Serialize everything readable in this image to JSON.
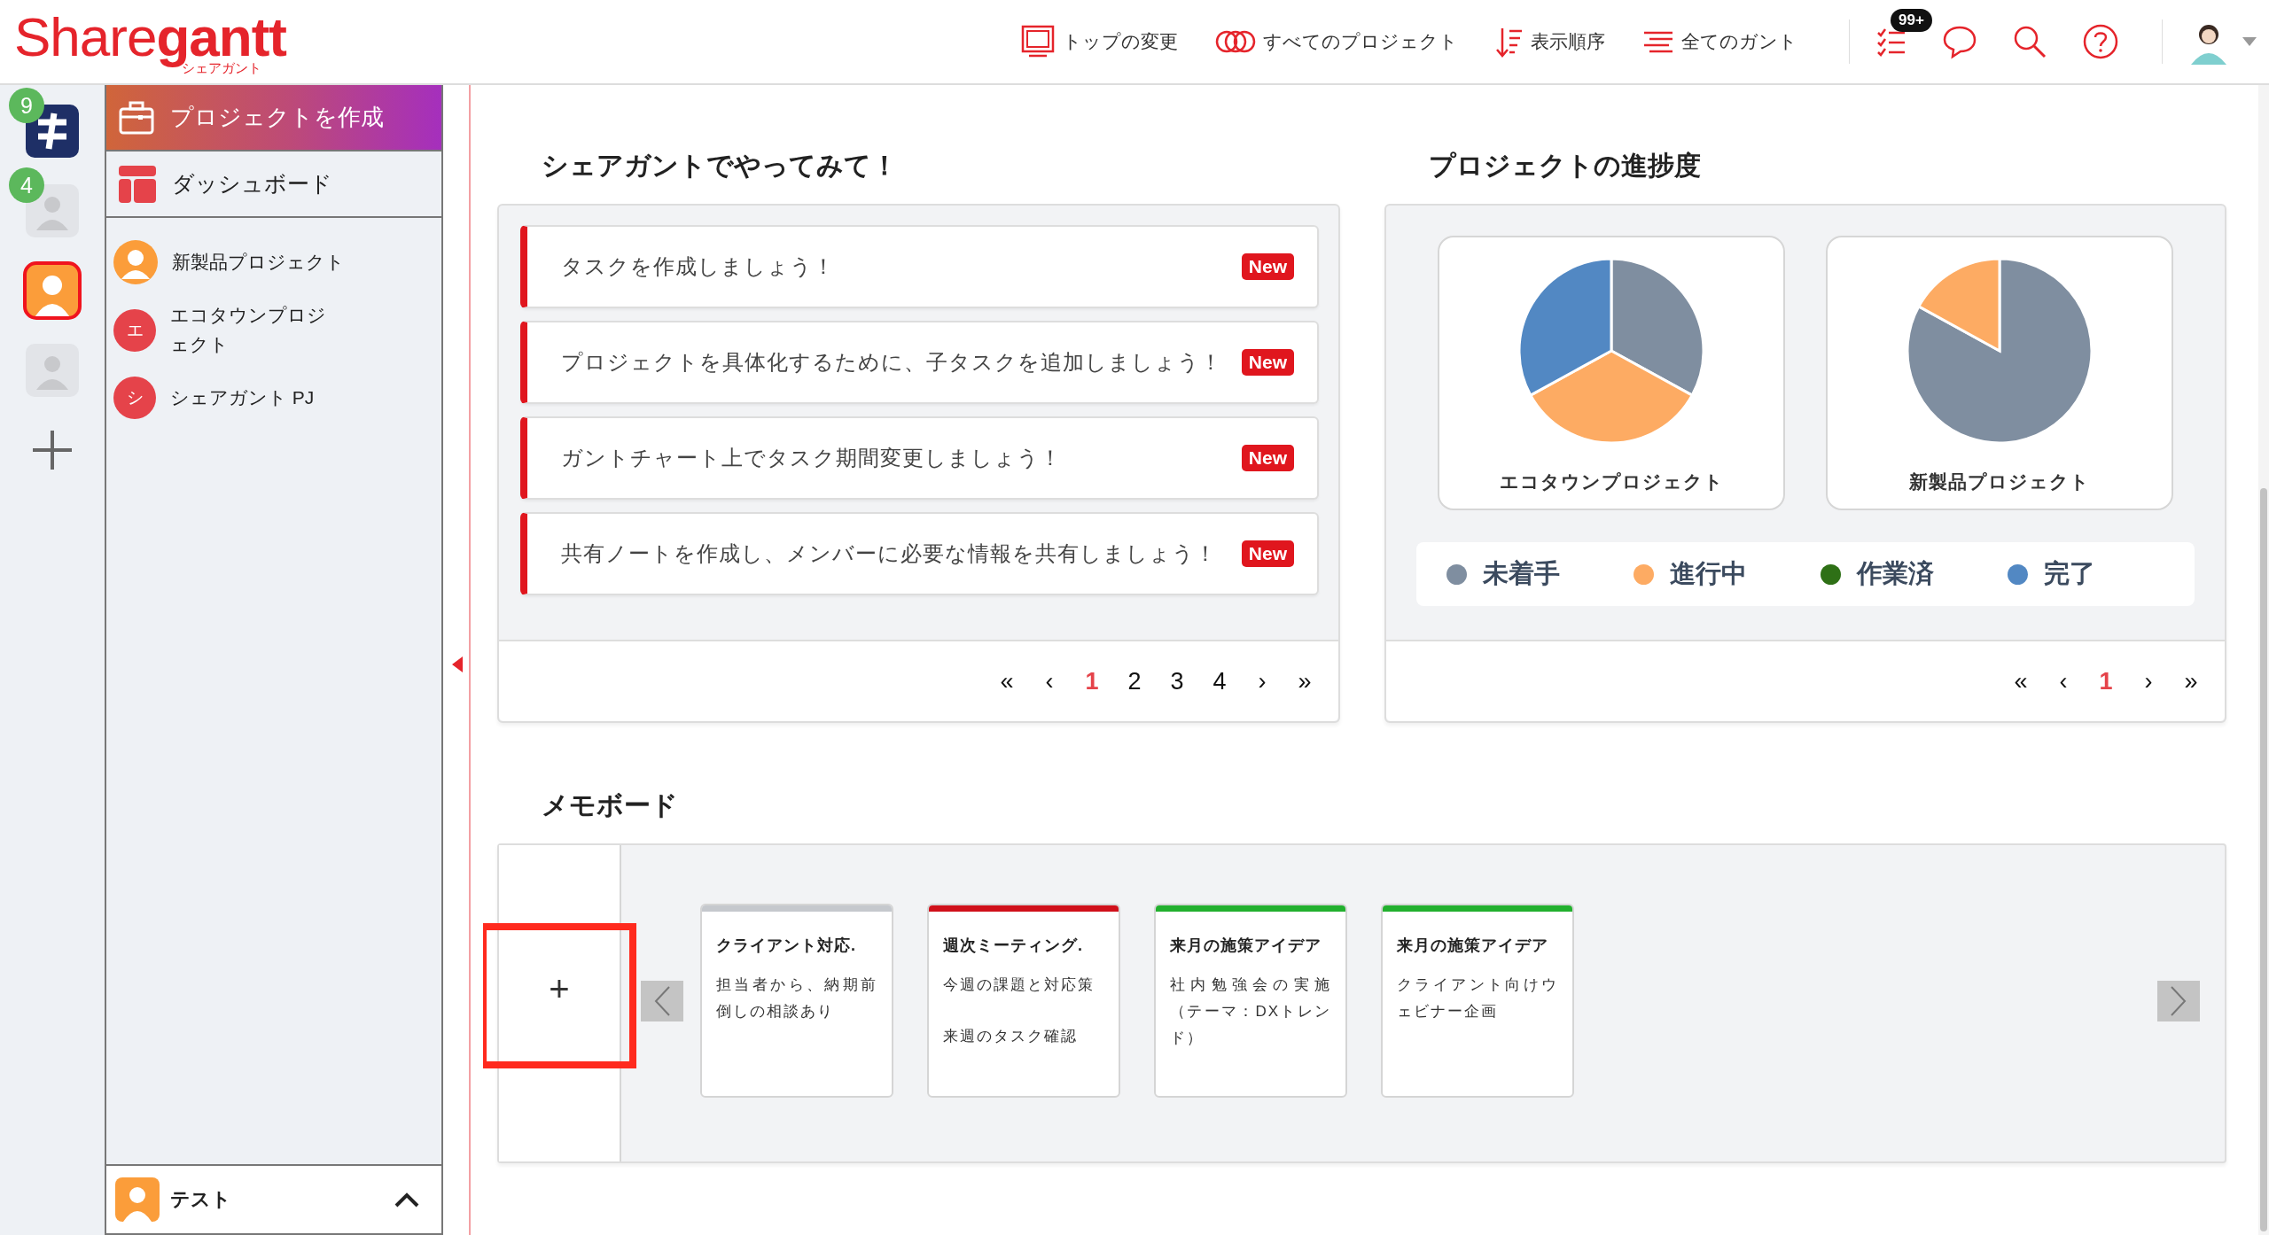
{
  "header": {
    "logo": "Share**gantt**",
    "logo_subtitle": "シェアガント",
    "nav": [
      {
        "kind": "screen",
        "label": "トップの変更"
      },
      {
        "kind": "circles",
        "label": "すべてのプロジェクト"
      },
      {
        "kind": "sort",
        "label": "表示順序"
      },
      {
        "kind": "lines",
        "label": "全てのガント"
      }
    ],
    "task_badge": "99+"
  },
  "rail": [
    {
      "kind": "app",
      "badge": "9",
      "selected": false
    },
    {
      "kind": "person",
      "badge": "4",
      "selected": false
    },
    {
      "kind": "character",
      "selected": true
    },
    {
      "kind": "person",
      "selected": false
    },
    {
      "kind": "add",
      "selected": false
    }
  ],
  "sidebar": {
    "create_button": "プロジェクトを作成",
    "dashboard": "ダッシュボード",
    "projects": [
      {
        "kind": "image",
        "name": "新製品プロジェクト"
      },
      {
        "kind": "letter",
        "initial": "エ",
        "name": "エコタウンプロジェクト"
      },
      {
        "kind": "letter",
        "initial": "シ",
        "name": "シェアガント PJ"
      }
    ],
    "user": {
      "name": "テスト",
      "expanded": true
    }
  },
  "tasks": {
    "title": "シェアガントでやってみて！",
    "items": [
      {
        "text": "タスクを作成しましょう！",
        "badge": "New"
      },
      {
        "text": "プロジェクトを具体化するために、子タスクを追加しましょう！",
        "badge": "New"
      },
      {
        "text": "ガントチャート上でタスク期間変更しましょう！",
        "badge": "New"
      },
      {
        "text": "共有ノートを作成し、メンバーに必要な情報を共有しましょう！",
        "badge": "New"
      }
    ],
    "pages": [
      {
        "label": "«",
        "selected": false
      },
      {
        "label": "‹",
        "selected": false
      },
      {
        "label": "1",
        "selected": true
      },
      {
        "label": "2",
        "selected": false
      },
      {
        "label": "3",
        "selected": false
      },
      {
        "label": "4",
        "selected": false
      },
      {
        "label": "›",
        "selected": false
      },
      {
        "label": "»",
        "selected": false
      }
    ]
  },
  "progress": {
    "title": "プロジェクトの進捗度",
    "charts": [
      {
        "chart_data": {
          "type": "pie",
          "title": "エコタウンプロジェクト",
          "values": [
            33,
            34,
            0,
            33
          ]
        }
      },
      {
        "chart_data": {
          "type": "pie",
          "title": "新製品プロジェクト",
          "values": [
            83,
            17,
            0,
            0
          ]
        }
      }
    ],
    "legend": [
      {
        "label": "未着手",
        "color": "#7f8ea0"
      },
      {
        "label": "進行中",
        "color": "#fdab63"
      },
      {
        "label": "作業済",
        "color": "#2e7016"
      },
      {
        "label": "完了",
        "color": "#5288c3"
      }
    ],
    "pages": [
      {
        "label": "«",
        "selected": false
      },
      {
        "label": "‹",
        "selected": false
      },
      {
        "label": "1",
        "selected": true
      },
      {
        "label": "›",
        "selected": false
      },
      {
        "label": "»",
        "selected": false
      }
    ]
  },
  "memo": {
    "title": "メモボード",
    "add_button": "+",
    "add_highlighted": true,
    "cards": [
      {
        "color": "#c5c8cd",
        "title": "クライアント対応.",
        "body": [
          "担当者から、納期前倒しの相談あり"
        ]
      },
      {
        "color": "#d0101a",
        "title": "週次ミーティング.",
        "body": [
          "今週の課題と対応策",
          "来週のタスク確認"
        ]
      },
      {
        "color": "#22b02e",
        "title": "来月の施策アイデア",
        "body": [
          "社内勉強会の実施（テーマ：DXトレンド）"
        ]
      },
      {
        "color": "#22b02e",
        "title": "来月の施策アイデア",
        "body": [
          "クライアント向けウェビナー企画"
        ]
      }
    ]
  }
}
